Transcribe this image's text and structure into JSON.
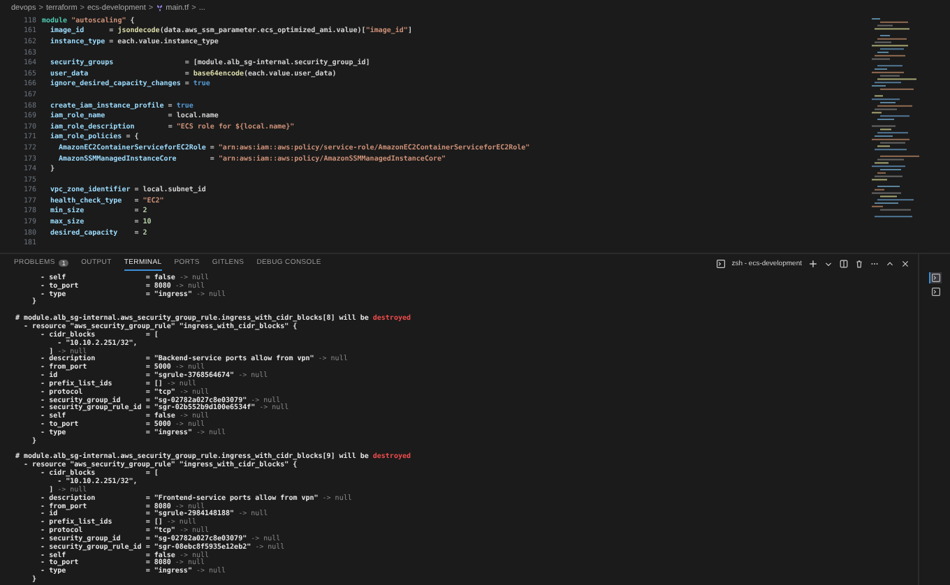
{
  "breadcrumb": {
    "items": [
      "devops",
      "terraform",
      "ecs-development",
      "main.tf",
      "..."
    ],
    "separator": ">"
  },
  "editor": {
    "lines": [
      {
        "number": "118",
        "tokens": [
          {
            "kind": "keyword",
            "text": "module "
          },
          {
            "kind": "string",
            "text": "\"autoscaling\""
          },
          {
            "kind": "plain",
            "text": " {"
          }
        ],
        "children": [
          {
            "number": "161",
            "tokens": [
              {
                "kind": "key",
                "text": "image_id"
              },
              {
                "kind": "plain",
                "text": "      = "
              },
              {
                "kind": "fn",
                "text": "jsondecode"
              },
              {
                "kind": "plain",
                "text": "(data.aws_ssm_parameter.ecs_optimized_ami.value)["
              },
              {
                "kind": "string",
                "text": "\"image_id\""
              },
              {
                "kind": "plain",
                "text": "]"
              }
            ]
          },
          {
            "number": "162",
            "tokens": [
              {
                "kind": "key",
                "text": "instance_type"
              },
              {
                "kind": "plain",
                "text": " = each.value.instance_type"
              }
            ]
          },
          {
            "number": "163"
          },
          {
            "number": "164",
            "tokens": [
              {
                "kind": "key",
                "text": "security_groups"
              },
              {
                "kind": "plain",
                "text": "                 = [module.alb_sg-internal.security_group_id]"
              }
            ]
          },
          {
            "number": "165",
            "tokens": [
              {
                "kind": "key",
                "text": "user_data"
              },
              {
                "kind": "plain",
                "text": "                       = "
              },
              {
                "kind": "fn",
                "text": "base64encode"
              },
              {
                "kind": "plain",
                "text": "(each.value.user_data)"
              }
            ]
          },
          {
            "number": "166",
            "tokens": [
              {
                "kind": "key",
                "text": "ignore_desired_capacity_changes"
              },
              {
                "kind": "plain",
                "text": " = "
              },
              {
                "kind": "bool",
                "text": "true"
              }
            ]
          },
          {
            "number": "167"
          },
          {
            "number": "168",
            "tokens": [
              {
                "kind": "key",
                "text": "create_iam_instance_profile"
              },
              {
                "kind": "plain",
                "text": " = "
              },
              {
                "kind": "bool",
                "text": "true"
              }
            ]
          },
          {
            "number": "169",
            "tokens": [
              {
                "kind": "key",
                "text": "iam_role_name"
              },
              {
                "kind": "plain",
                "text": "               = local.name"
              }
            ]
          },
          {
            "number": "170",
            "tokens": [
              {
                "kind": "key",
                "text": "iam_role_description"
              },
              {
                "kind": "plain",
                "text": "        = "
              },
              {
                "kind": "string",
                "text": "\"ECS role for ${local.name}\""
              }
            ]
          },
          {
            "number": "171",
            "tokens": [
              {
                "kind": "key",
                "text": "iam_role_policies"
              },
              {
                "kind": "plain",
                "text": " = {"
              }
            ],
            "children": [
              {
                "number": "172",
                "tokens": [
                  {
                    "kind": "key",
                    "text": "AmazonEC2ContainerServiceforEC2Role"
                  },
                  {
                    "kind": "plain",
                    "text": " = "
                  },
                  {
                    "kind": "string",
                    "text": "\"arn:aws:iam::aws:policy/service-role/AmazonEC2ContainerServiceforEC2Role\""
                  }
                ]
              },
              {
                "number": "173",
                "tokens": [
                  {
                    "kind": "key",
                    "text": "AmazonSSMManagedInstanceCore"
                  },
                  {
                    "kind": "plain",
                    "text": "        = "
                  },
                  {
                    "kind": "string",
                    "text": "\"arn:aws:iam::aws:policy/AmazonSSMManagedInstanceCore\""
                  }
                ]
              }
            ]
          },
          {
            "number": "174",
            "tokens": [
              {
                "kind": "plain",
                "text": "}"
              }
            ]
          },
          {
            "number": "175"
          },
          {
            "number": "176",
            "tokens": [
              {
                "kind": "key",
                "text": "vpc_zone_identifier"
              },
              {
                "kind": "plain",
                "text": " = local.subnet_id"
              }
            ]
          },
          {
            "number": "177",
            "tokens": [
              {
                "kind": "key",
                "text": "health_check_type"
              },
              {
                "kind": "plain",
                "text": "   = "
              },
              {
                "kind": "string",
                "text": "\"EC2\""
              }
            ]
          },
          {
            "number": "178",
            "tokens": [
              {
                "kind": "key",
                "text": "min_size"
              },
              {
                "kind": "plain",
                "text": "            = "
              },
              {
                "kind": "number",
                "text": "2"
              }
            ]
          },
          {
            "number": "179",
            "tokens": [
              {
                "kind": "key",
                "text": "max_size"
              },
              {
                "kind": "plain",
                "text": "            = "
              },
              {
                "kind": "number",
                "text": "10"
              }
            ]
          },
          {
            "number": "180",
            "tokens": [
              {
                "kind": "key",
                "text": "desired_capacity"
              },
              {
                "kind": "plain",
                "text": "    = "
              },
              {
                "kind": "number",
                "text": "2"
              }
            ]
          },
          {
            "number": "181"
          }
        ]
      }
    ]
  },
  "panel": {
    "tabs": [
      {
        "label": "PROBLEMS",
        "badge": "1",
        "selected": false
      },
      {
        "label": "OUTPUT",
        "selected": false
      },
      {
        "label": "TERMINAL",
        "selected": true
      },
      {
        "label": "PORTS",
        "selected": false
      },
      {
        "label": "GITLENS",
        "selected": false
      },
      {
        "label": "DEBUG CONSOLE",
        "selected": false
      }
    ],
    "terminal_title": "zsh - ecs-development",
    "assign": "=",
    "terminals": [
      {
        "selected": true
      },
      {
        "selected": false
      }
    ],
    "lines": [
      {
        "kind": "attr",
        "marker": "-",
        "name": "self",
        "value": "false",
        "change": "-> null"
      },
      {
        "kind": "attr",
        "marker": "-",
        "name": "to_port",
        "value": "8080",
        "change": "-> null"
      },
      {
        "kind": "attr",
        "marker": "-",
        "name": "type",
        "value": "\"ingress\"",
        "change": "-> null"
      },
      {
        "kind": "block_end",
        "text": "}"
      },
      {
        "kind": "blank"
      },
      {
        "kind": "heading",
        "text": "# module.alb_sg-internal.aws_security_group_rule.ingress_with_cidr_blocks[8] will be",
        "alert": "destroyed"
      },
      {
        "kind": "resource",
        "marker": "-",
        "text": "resource \"aws_security_group_rule\" \"ingress_with_cidr_blocks\" {"
      },
      {
        "kind": "attr",
        "marker": "-",
        "name": "cidr_blocks",
        "value": "["
      },
      {
        "kind": "item",
        "marker": "-",
        "text": "\"10.10.2.251/32\","
      },
      {
        "kind": "list_end",
        "text": "]",
        "change": "-> null"
      },
      {
        "kind": "attr",
        "marker": "-",
        "name": "description",
        "value": "\"Backend-service ports allow from vpn\"",
        "change": "-> null"
      },
      {
        "kind": "attr",
        "marker": "-",
        "name": "from_port",
        "value": "5000",
        "change": "-> null"
      },
      {
        "kind": "attr",
        "marker": "-",
        "name": "id",
        "value": "\"sgrule-3768564674\"",
        "change": "-> null"
      },
      {
        "kind": "attr",
        "marker": "-",
        "name": "prefix_list_ids",
        "value": "[]",
        "change": "-> null"
      },
      {
        "kind": "attr",
        "marker": "-",
        "name": "protocol",
        "value": "\"tcp\"",
        "change": "-> null"
      },
      {
        "kind": "attr",
        "marker": "-",
        "name": "security_group_id",
        "value": "\"sg-02782a027c8e03079\"",
        "change": "-> null"
      },
      {
        "kind": "attr",
        "marker": "-",
        "name": "security_group_rule_id",
        "value": "\"sgr-02b552b9d100e6534f\"",
        "change": "-> null"
      },
      {
        "kind": "attr",
        "marker": "-",
        "name": "self",
        "value": "false",
        "change": "-> null"
      },
      {
        "kind": "attr",
        "marker": "-",
        "name": "to_port",
        "value": "5000",
        "change": "-> null"
      },
      {
        "kind": "attr",
        "marker": "-",
        "name": "type",
        "value": "\"ingress\"",
        "change": "-> null"
      },
      {
        "kind": "block_end",
        "text": "}"
      },
      {
        "kind": "blank"
      },
      {
        "kind": "heading",
        "text": "# module.alb_sg-internal.aws_security_group_rule.ingress_with_cidr_blocks[9] will be",
        "alert": "destroyed"
      },
      {
        "kind": "resource",
        "marker": "-",
        "text": "resource \"aws_security_group_rule\" \"ingress_with_cidr_blocks\" {"
      },
      {
        "kind": "attr",
        "marker": "-",
        "name": "cidr_blocks",
        "value": "["
      },
      {
        "kind": "item",
        "marker": "-",
        "text": "\"10.10.2.251/32\","
      },
      {
        "kind": "list_end",
        "text": "]",
        "change": "-> null"
      },
      {
        "kind": "attr",
        "marker": "-",
        "name": "description",
        "value": "\"Frontend-service ports allow from vpn\"",
        "change": "-> null"
      },
      {
        "kind": "attr",
        "marker": "-",
        "name": "from_port",
        "value": "8080",
        "change": "-> null"
      },
      {
        "kind": "attr",
        "marker": "-",
        "name": "id",
        "value": "\"sgrule-2984148188\"",
        "change": "-> null"
      },
      {
        "kind": "attr",
        "marker": "-",
        "name": "prefix_list_ids",
        "value": "[]",
        "change": "-> null"
      },
      {
        "kind": "attr",
        "marker": "-",
        "name": "protocol",
        "value": "\"tcp\"",
        "change": "-> null"
      },
      {
        "kind": "attr",
        "marker": "-",
        "name": "security_group_id",
        "value": "\"sg-02782a027c8e03079\"",
        "change": "-> null"
      },
      {
        "kind": "attr",
        "marker": "-",
        "name": "security_group_rule_id",
        "value": "\"sgr-08ebc8f5935e12eb2\"",
        "change": "-> null"
      },
      {
        "kind": "attr",
        "marker": "-",
        "name": "self",
        "value": "false",
        "change": "-> null"
      },
      {
        "kind": "attr",
        "marker": "-",
        "name": "to_port",
        "value": "8080",
        "change": "-> null"
      },
      {
        "kind": "attr",
        "marker": "-",
        "name": "type",
        "value": "\"ingress\"",
        "change": "-> null"
      },
      {
        "kind": "block_end",
        "text": "}"
      }
    ]
  }
}
